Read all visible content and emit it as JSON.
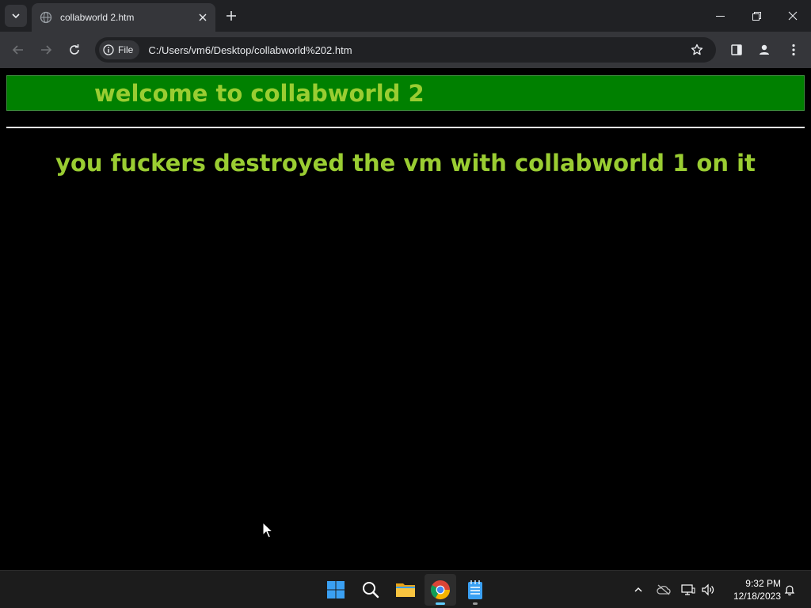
{
  "browser": {
    "tab": {
      "title": "collabworld 2.htm"
    },
    "address_bar": {
      "security_label": "File",
      "url": "C:/Users/vm6/Desktop/collabworld%202.htm"
    }
  },
  "page": {
    "banner_text": "welcome to collabworld 2",
    "headline": "you fuckers destroyed the vm with collabworld 1 on it",
    "colors": {
      "background": "#000000",
      "banner": "#008000",
      "text": "#9acd32",
      "rule": "#e8e8e8"
    }
  },
  "taskbar": {
    "apps": [
      "start-icon",
      "search-icon",
      "file-explorer-icon",
      "chrome-icon",
      "notepad-icon"
    ],
    "clock": {
      "time": "9:32 PM",
      "date": "12/18/2023"
    }
  }
}
